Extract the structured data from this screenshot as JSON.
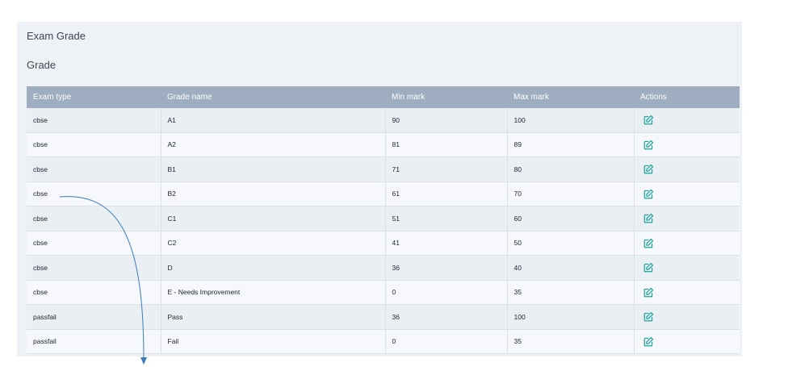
{
  "panel": {
    "page_title": "Exam Grade",
    "section_title": "Grade"
  },
  "table": {
    "columns": [
      "Exam type",
      "Grade name",
      "Min mark",
      "Max mark",
      "Actions"
    ],
    "rows": [
      {
        "exam_type": "cbse",
        "grade_name": "A1",
        "min_mark": "90",
        "max_mark": "100"
      },
      {
        "exam_type": "cbse",
        "grade_name": "A2",
        "min_mark": "81",
        "max_mark": "89"
      },
      {
        "exam_type": "cbse",
        "grade_name": "B1",
        "min_mark": "71",
        "max_mark": "80"
      },
      {
        "exam_type": "cbse",
        "grade_name": "B2",
        "min_mark": "61",
        "max_mark": "70"
      },
      {
        "exam_type": "cbse",
        "grade_name": "C1",
        "min_mark": "51",
        "max_mark": "60"
      },
      {
        "exam_type": "cbse",
        "grade_name": "C2",
        "min_mark": "41",
        "max_mark": "50"
      },
      {
        "exam_type": "cbse",
        "grade_name": "D",
        "min_mark": "36",
        "max_mark": "40"
      },
      {
        "exam_type": "cbse",
        "grade_name": "E - Needs Improvement",
        "min_mark": "0",
        "max_mark": "35"
      },
      {
        "exam_type": "passfail",
        "grade_name": "Pass",
        "min_mark": "36",
        "max_mark": "100"
      },
      {
        "exam_type": "passfail",
        "grade_name": "Fail",
        "min_mark": "0",
        "max_mark": "35"
      }
    ],
    "action_icon": "edit-icon"
  },
  "colors": {
    "header_bg": "#9eadbf",
    "panel_bg": "#eef2f6",
    "edit_icon": "#1aa39a",
    "arrow": "#3b7cc0"
  }
}
